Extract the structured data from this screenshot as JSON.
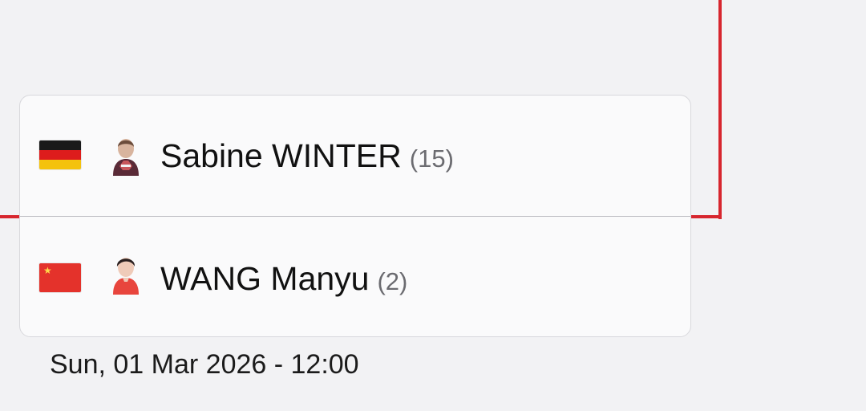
{
  "match": {
    "players": [
      {
        "name": "Sabine WINTER",
        "seed": "(15)",
        "country_flag": "flag-germany-icon",
        "avatar_icon": "player-avatar-icon"
      },
      {
        "name": "WANG Manyu",
        "seed": "(2)",
        "country_flag": "flag-china-icon",
        "avatar_icon": "player-avatar-icon"
      }
    ],
    "datetime": "Sun, 01 Mar 2026 - 12:00"
  },
  "colors": {
    "bracket_line": "#d7262e",
    "background": "#f2f2f4",
    "card": "#fafafb"
  }
}
